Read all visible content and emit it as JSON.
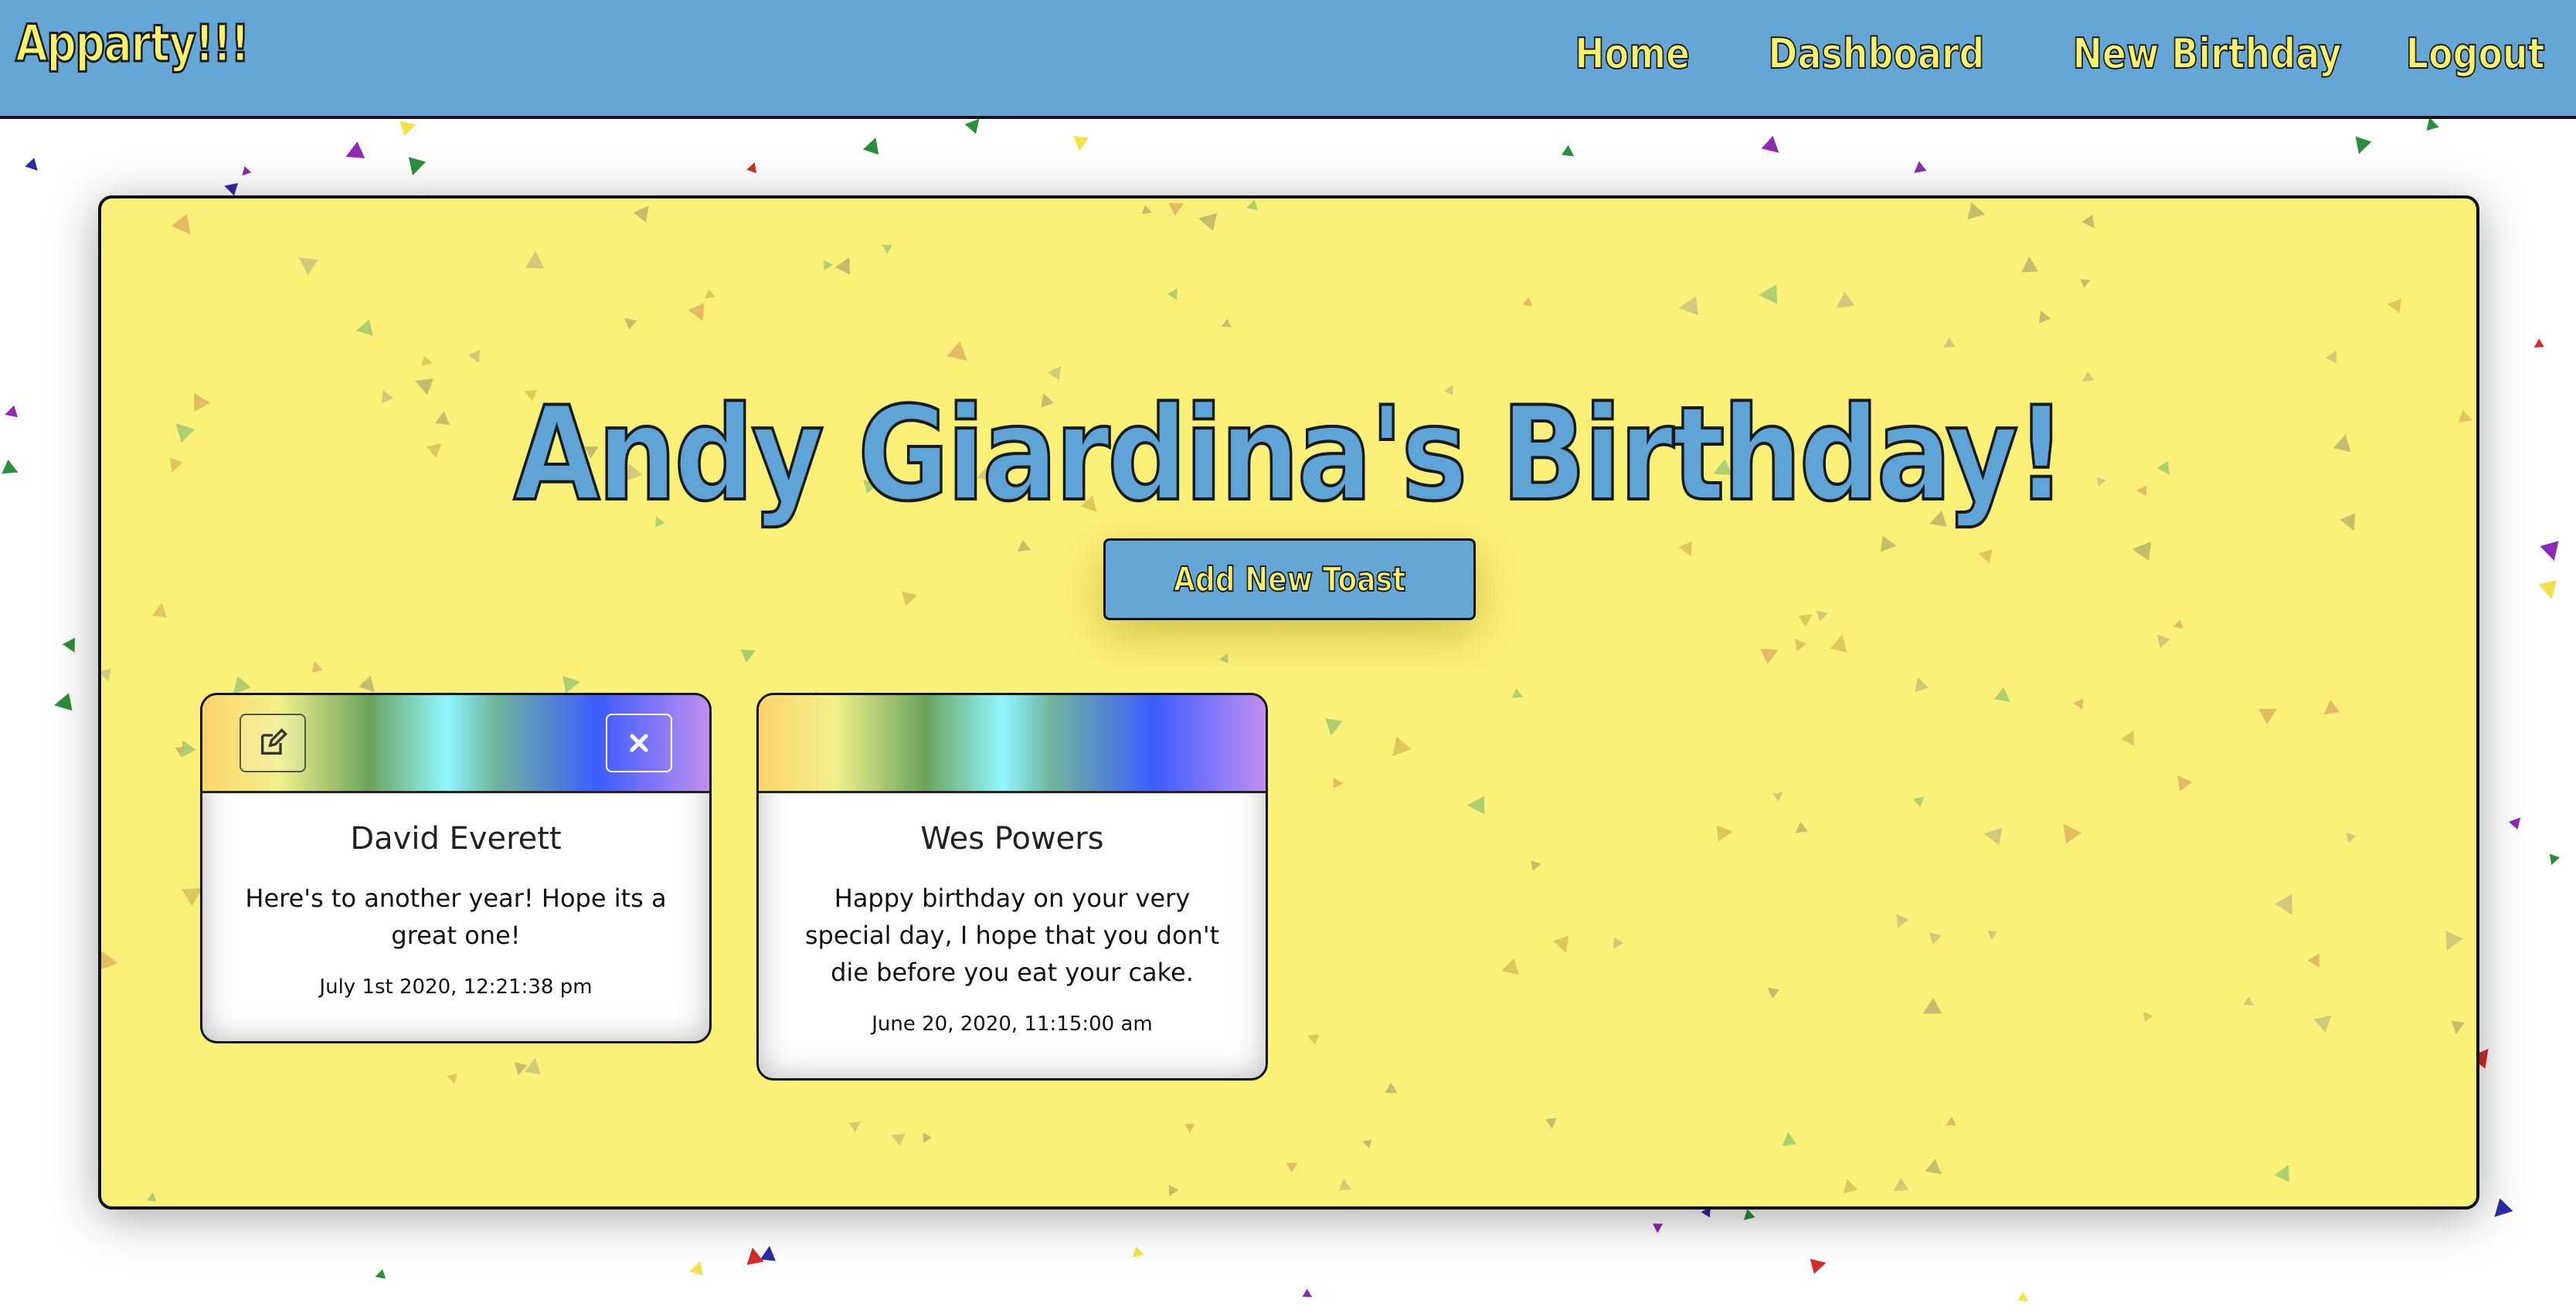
{
  "navbar": {
    "brand": "Apparty!!!",
    "links": [
      "Home",
      "Dashboard",
      "New Birthday",
      "Logout"
    ]
  },
  "page": {
    "title": "Andy Giardina's Birthday!",
    "add_button_label": "Add New Toast"
  },
  "toasts": [
    {
      "name": "David Everett",
      "message": "Here's to another year! Hope its a great one!",
      "date": "July 1st 2020, 12:21:38 pm",
      "has_controls": true
    },
    {
      "name": "Wes Powers",
      "message": "Happy birthday on your very special day, I hope that you don't die before you eat your cake.",
      "date": "June 20, 2020, 11:15:00 am",
      "has_controls": false
    }
  ],
  "icons": {
    "edit": "pencil-square-icon",
    "close": "close-icon"
  },
  "colors": {
    "navbar": "#64a7d7",
    "brand_text": "#fff16a",
    "card_background": "#fcf178",
    "title_text": "#5ea4d6"
  }
}
